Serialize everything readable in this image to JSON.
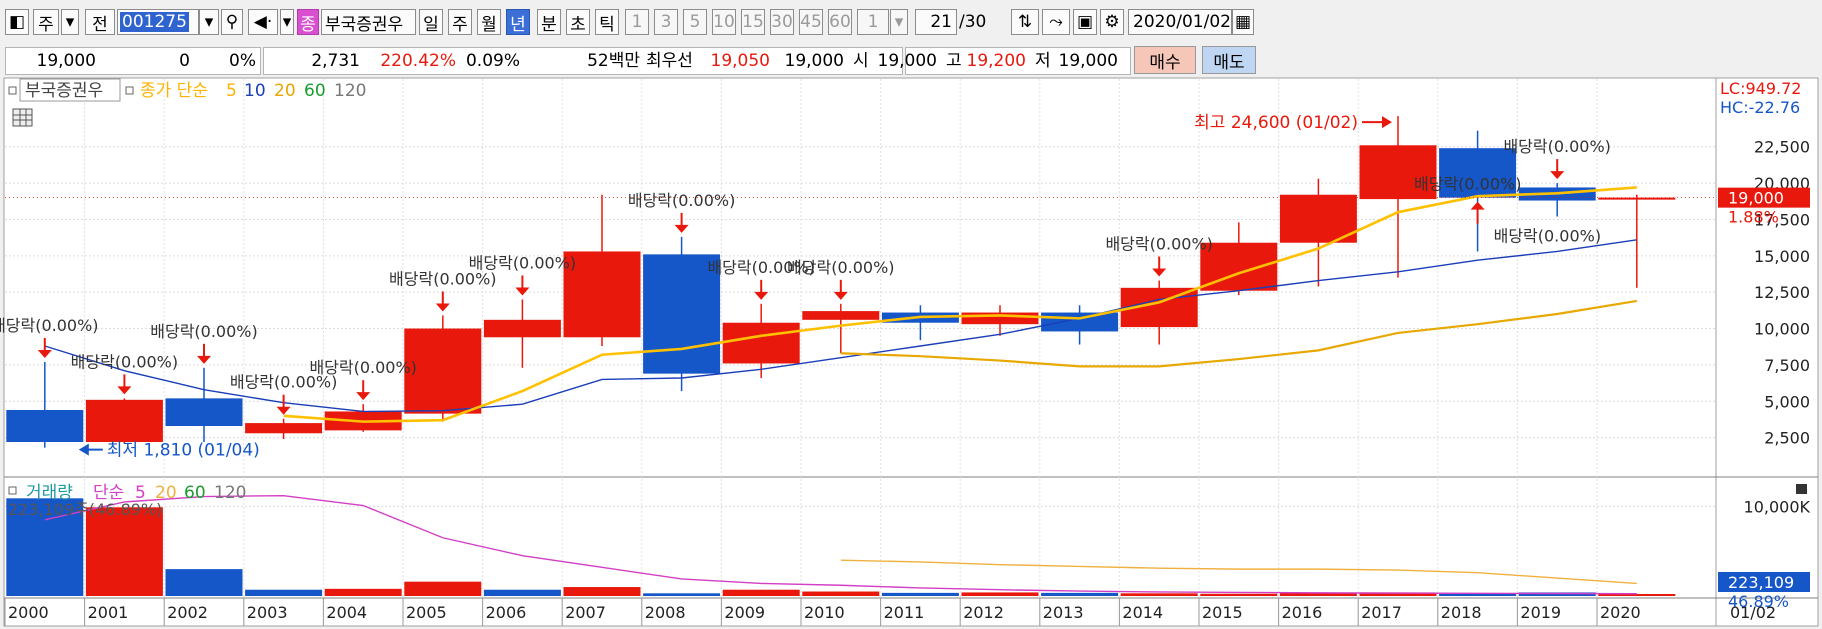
{
  "toolbar": {
    "market": "주",
    "type": "전",
    "code": "001275",
    "stock_tag": "종",
    "stock_name": "부국증권우",
    "periods": [
      "일",
      "주",
      "월",
      "년",
      "분",
      "초",
      "틱"
    ],
    "active_period": "년",
    "intervals": [
      "1",
      "3",
      "5",
      "10",
      "15",
      "30",
      "45",
      "60"
    ],
    "interval_value": "1",
    "count": "21",
    "count_total": "/30",
    "date": "2020/01/02"
  },
  "info": {
    "price": "19,000",
    "change": "0",
    "change_pct": "0%",
    "volume": "2,731",
    "vol_ratio": "220.42%",
    "turnover": "0.09%",
    "amount": "52백만",
    "best_label": "최우선",
    "best_ask": "19,050",
    "best_bid": "19,000",
    "open_label": "시",
    "open": "19,000",
    "high_label": "고",
    "high": "19,200",
    "low_label": "저",
    "low": "19,000",
    "buy_label": "매수",
    "sell_label": "매도"
  },
  "colors": {
    "up": "#e8190c",
    "down": "#1556c8",
    "ma5": "#1b3fb8",
    "ma10": "#ffc000",
    "ma20": "#e8a800",
    "vol_ma5": "#d23fc6",
    "vol_ma20": "#f0b040"
  },
  "chart_data": [
    {
      "type": "candlestick",
      "legend": {
        "name": "부국증권우",
        "ma_label": "종가 단순",
        "ma": [
          "5",
          "10",
          "20",
          "60",
          "120"
        ]
      },
      "x": [
        "2000",
        "2001",
        "2002",
        "2003",
        "2004",
        "2005",
        "2006",
        "2007",
        "2008",
        "2009",
        "2010",
        "2011",
        "2012",
        "2013",
        "2014",
        "2015",
        "2016",
        "2017",
        "2018",
        "2019",
        "2020"
      ],
      "open": [
        4400,
        2200,
        5200,
        2800,
        3000,
        4150,
        9400,
        9400,
        15100,
        7600,
        10600,
        11100,
        10300,
        11100,
        10100,
        12600,
        15900,
        18900,
        22400,
        19700,
        19000
      ],
      "high": [
        7700,
        5200,
        7300,
        3800,
        4800,
        10900,
        12000,
        19200,
        16300,
        11700,
        11700,
        11600,
        11600,
        11600,
        13300,
        17300,
        20300,
        24600,
        23600,
        20000,
        19200
      ],
      "low": [
        1810,
        2100,
        2200,
        2400,
        2900,
        3600,
        7300,
        8800,
        5700,
        6600,
        8300,
        9200,
        9500,
        8900,
        8900,
        12300,
        12900,
        13500,
        15300,
        17700,
        12800
      ],
      "close": [
        2200,
        5100,
        3300,
        3500,
        4300,
        10000,
        10600,
        15300,
        6900,
        10400,
        11200,
        10400,
        11100,
        9800,
        12800,
        15900,
        19200,
        22600,
        19000,
        18800,
        19000
      ],
      "ma5": [
        8800,
        7100,
        5800,
        4900,
        4300,
        4350,
        4800,
        6500,
        6600,
        7200,
        8000,
        8800,
        9600,
        10700,
        12000,
        12600,
        13300,
        13900,
        14700,
        15300,
        16100
      ],
      "ma10": [
        null,
        null,
        null,
        4000,
        3600,
        3700,
        5700,
        8200,
        8600,
        9500,
        10200,
        10800,
        10900,
        10700,
        11800,
        13800,
        15500,
        18000,
        19100,
        19300,
        19700
      ],
      "ma20": [
        null,
        null,
        null,
        null,
        null,
        null,
        null,
        null,
        null,
        null,
        8300,
        8100,
        7800,
        7400,
        7400,
        7900,
        8500,
        9700,
        10300,
        11000,
        11900
      ],
      "ylim": [
        0,
        25300
      ],
      "yticks": [
        "2,500",
        "5,000",
        "7,500",
        "10,000",
        "12,500",
        "15,000",
        "17,500",
        "20,000",
        "22,500"
      ],
      "ytick_values": [
        2500,
        5000,
        7500,
        10000,
        12500,
        15000,
        17500,
        20000,
        22500
      ],
      "lc": "LC:949.72",
      "hc": "HC:-22.76",
      "current_price": 19000,
      "current_price_label": "19,000",
      "current_pct_label": "1.88%",
      "annotations": [
        {
          "text": "최고 24,600 (01/02)",
          "index": 17,
          "value": 24600,
          "kind": "high"
        },
        {
          "text": "최저 1,810 (01/04)",
          "index": 0,
          "value": 1810,
          "kind": "low"
        }
      ],
      "dividend_label": "배당락(0.00%)",
      "dividend_markers": [
        {
          "index": 0,
          "dir": "down"
        },
        {
          "index": 1,
          "dir": "down"
        },
        {
          "index": 2,
          "dir": "down"
        },
        {
          "index": 3,
          "dir": "down"
        },
        {
          "index": 4,
          "dir": "down"
        },
        {
          "index": 5,
          "dir": "down"
        },
        {
          "index": 6,
          "dir": "down"
        },
        {
          "index": 8,
          "dir": "down"
        },
        {
          "index": 9,
          "dir": "down"
        },
        {
          "index": 10,
          "dir": "down"
        },
        {
          "index": 14,
          "dir": "down"
        },
        {
          "index": 17,
          "dir": "up"
        },
        {
          "index": 18,
          "dir": "up"
        },
        {
          "index": 19,
          "dir": "down"
        }
      ]
    },
    {
      "type": "bar",
      "legend": {
        "name": "거래량",
        "ma_label": "단순",
        "ma": [
          "5",
          "20",
          "60",
          "120"
        ]
      },
      "x": [
        "2000",
        "2001",
        "2002",
        "2003",
        "2004",
        "2005",
        "2006",
        "2007",
        "2008",
        "2009",
        "2010",
        "2011",
        "2012",
        "2013",
        "2014",
        "2015",
        "2016",
        "2017",
        "2018",
        "2019",
        "2020"
      ],
      "values": [
        10900,
        9900,
        3000,
        700,
        800,
        1600,
        700,
        1000,
        300,
        700,
        500,
        350,
        400,
        350,
        300,
        250,
        350,
        400,
        250,
        400,
        223
      ],
      "up": [
        false,
        true,
        false,
        false,
        true,
        true,
        false,
        true,
        false,
        true,
        true,
        false,
        true,
        false,
        true,
        true,
        true,
        true,
        false,
        false,
        true
      ],
      "ma5": [
        8500,
        10500,
        11100,
        11200,
        10100,
        6500,
        4500,
        3200,
        1900,
        1400,
        1200,
        900,
        700,
        550,
        450,
        400,
        350,
        320,
        300,
        280,
        250
      ],
      "ma20": [
        null,
        null,
        null,
        null,
        null,
        null,
        null,
        null,
        null,
        null,
        4000,
        3800,
        3500,
        3300,
        3100,
        3000,
        3000,
        2900,
        2600,
        2000,
        1400
      ],
      "ylim": [
        0,
        12500
      ],
      "yticks": [
        "10,000K"
      ],
      "ytick_values": [
        10000
      ],
      "top_label": "223,109주(46.89%)",
      "current_label": "223,109",
      "current_pct_label": "46.89%"
    }
  ],
  "date_axis": {
    "last_label": "01/02"
  }
}
